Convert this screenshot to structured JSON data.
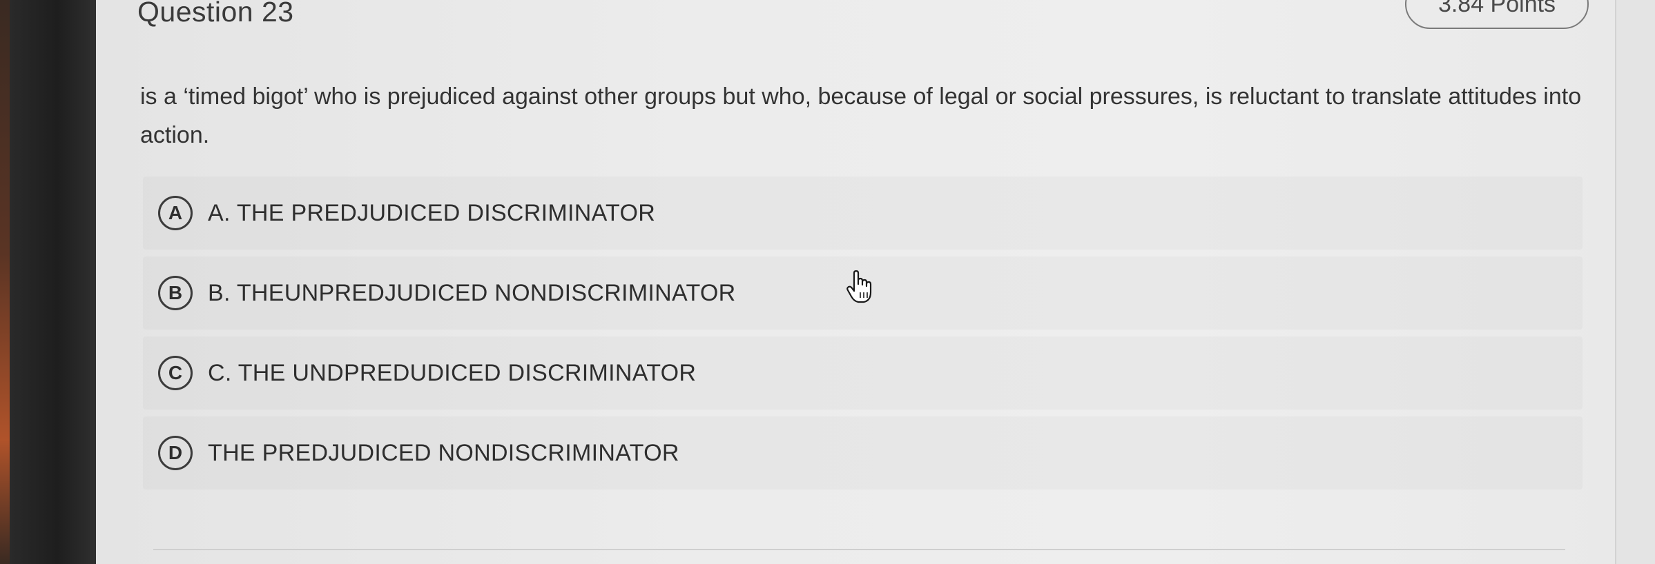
{
  "question": {
    "title": "Question 23",
    "points": "3.84 Points",
    "prompt": "is a ‘timed bigot’ who is prejudiced against other groups but who, because of legal or social pressures, is reluctant to translate attitudes into action."
  },
  "options": [
    {
      "letter": "A",
      "text": "A. THE PREDJUDICED DISCRIMINATOR"
    },
    {
      "letter": "B",
      "text": "B. THEUNPREDJUDICED NONDISCRIMINATOR"
    },
    {
      "letter": "C",
      "text": "C. THE UNDPREDUDICED DISCRIMINATOR"
    },
    {
      "letter": "D",
      "text": "THE PREDJUDICED NONDISCRIMINATOR"
    }
  ],
  "icons": {
    "cursor": "hand-pointer-icon"
  }
}
